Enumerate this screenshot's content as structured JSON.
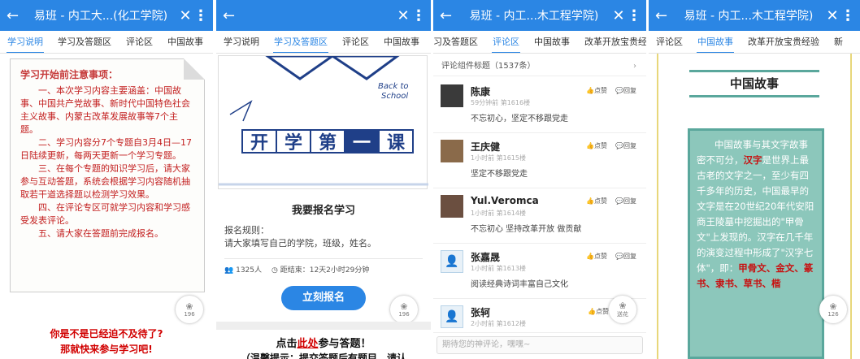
{
  "phones": [
    {
      "title": "易班 - 内工大...(化工学院)",
      "tabs": [
        "学习说明",
        "学习及答题区",
        "评论区",
        "中国故事"
      ],
      "note_heading": "学习开始前注意事项：",
      "note_paragraphs": [
        "一、本次学习内容主要涵盖：中国故事、中国共产党故事、新时代中国特色社会主义故事、内蒙古改革发展故事等7个主题。",
        "二、学习内容分7个专题自3月4日—17日陆续更新，每两天更新一个学习专题。",
        "三、在每个专题的知识学习后，请大家参与互动答题，系统会根据学习内容随机抽取若干道选择题以检测学习效果。",
        "四、在评论专区可就学习内容和学习感受发表评论。",
        "五、请大家在答题前完成报名。"
      ],
      "like_count": "196",
      "cta_line1": "你是不是已经迫不及待了?",
      "cta_line2": "那就快来参与学习吧!"
    },
    {
      "tabs": [
        "学习说明",
        "学习及答题区",
        "评论区",
        "中国故事"
      ],
      "banner_chars": [
        "开",
        "学",
        "第",
        "一",
        "课"
      ],
      "enroll_title": "我要报名学习",
      "rule_label": "报名规则：",
      "rule_text": "请大家填写自己的学院，班级，姓名。",
      "enroll_count": "1325人",
      "deadline": "距结束：12天2小时29分钟",
      "enroll_button": "立刻报名",
      "like_count": "196",
      "answer_prefix": "点击",
      "answer_link": "此处",
      "answer_suffix": "参与答题！",
      "answer_sub": "（温馨提示：提交答题后有题目，请认"
    },
    {
      "title": "易班 - 内工...木工程学院)",
      "tabs": [
        "习及答题区",
        "评论区",
        "中国故事",
        "改革开放宝贵经"
      ],
      "comment_header": "评论组件标题（1537条）",
      "like_label": "点赞",
      "reply_label": "回复",
      "comments": [
        {
          "name": "陈康",
          "time": "59分钟前 第1616楼",
          "text": "不忘初心，坚定不移跟党走"
        },
        {
          "name": "王庆健",
          "time": "1小时前 第1615楼",
          "text": "坚定不移跟党走"
        },
        {
          "name": "Yul.Veromca",
          "time": "1小时前 第1614楼",
          "text": "不忘初心 坚持改革开放 做贡献"
        },
        {
          "name": "张嘉晟",
          "time": "1小时前 第1613楼",
          "text": "阅读经典诗词丰富自己文化"
        },
        {
          "name": "张轲",
          "time": "2小时前 第1612楼",
          "text": ""
        }
      ],
      "like_count": "126",
      "fab_label": "送花",
      "input_placeholder": "期待您的神评论，嘿嘿~"
    },
    {
      "title": "易班 - 内工...木工程学院)",
      "tabs": [
        "评论区",
        "中国故事",
        "改革开放宝贵经验",
        "新"
      ],
      "story_title": "中国故事",
      "story_text_pre": "中国故事与其文字故事密不可分，",
      "story_red1": "汉字",
      "story_text_mid": "是世界上最古老的文字之一，至少有四千多年的历史，中国最早的文字是在20世纪20年代安阳商王陵墓中挖掘出的\"甲骨文\"上发现的。汉字在几千年的演变过程中形成了\"汉字七体\"，即：",
      "story_red2": "甲骨文、金文、篆书、隶书、草书、楷",
      "like_count": "126"
    }
  ]
}
